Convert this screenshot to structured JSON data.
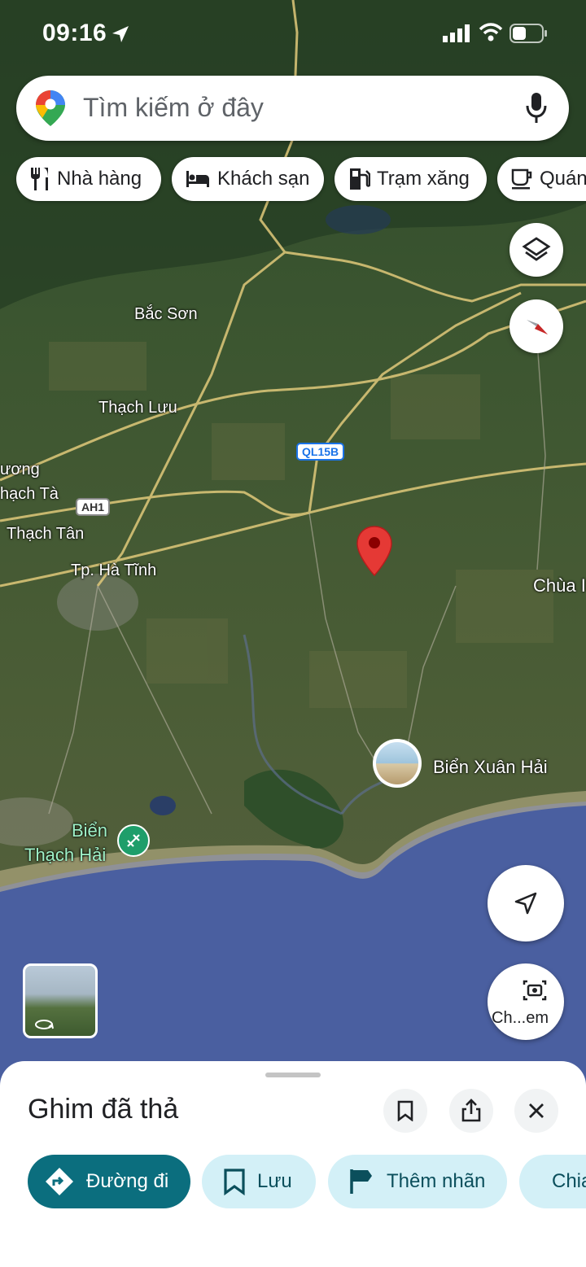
{
  "status_bar": {
    "time": "09:16"
  },
  "search": {
    "placeholder": "Tìm kiếm ở đây"
  },
  "chips": [
    {
      "label": "Nhà hàng",
      "icon": "fork-knife-icon"
    },
    {
      "label": "Khách sạn",
      "icon": "bed-icon"
    },
    {
      "label": "Trạm xăng",
      "icon": "gas-station-icon"
    },
    {
      "label": "Quán",
      "icon": "coffee-cup-icon"
    }
  ],
  "map": {
    "places": {
      "bac_son": "Bắc Sơn",
      "thach_luu": "Thạch Lưu",
      "thach_luong": "ương",
      "thach_ta": "hạch Tà",
      "thach_tan": "Thạch Tân",
      "ha_tinh": "Tp. Hà Tĩnh",
      "chua": "Chùa I",
      "bien_xuan_hai": "Biển Xuân Hải",
      "bien_thach_hai_1": "Biển",
      "bien_thach_hai_2": "Thạch Hải"
    },
    "road_shields": {
      "ql15b": "QL15B",
      "ah1": "AH1"
    }
  },
  "camera_button": {
    "label": "Ch...em"
  },
  "sheet": {
    "title": "Ghim đã thả",
    "actions": [
      {
        "label": "Đường đi",
        "icon": "directions-icon"
      },
      {
        "label": "Lưu",
        "icon": "bookmark-icon"
      },
      {
        "label": "Thêm nhãn",
        "icon": "flag-icon"
      },
      {
        "label": "Chia sẻ",
        "icon": "share-icon"
      }
    ]
  },
  "colors": {
    "accent": "#0b6e7e",
    "pin": "#e53935",
    "sea": "#4a5fa0"
  }
}
